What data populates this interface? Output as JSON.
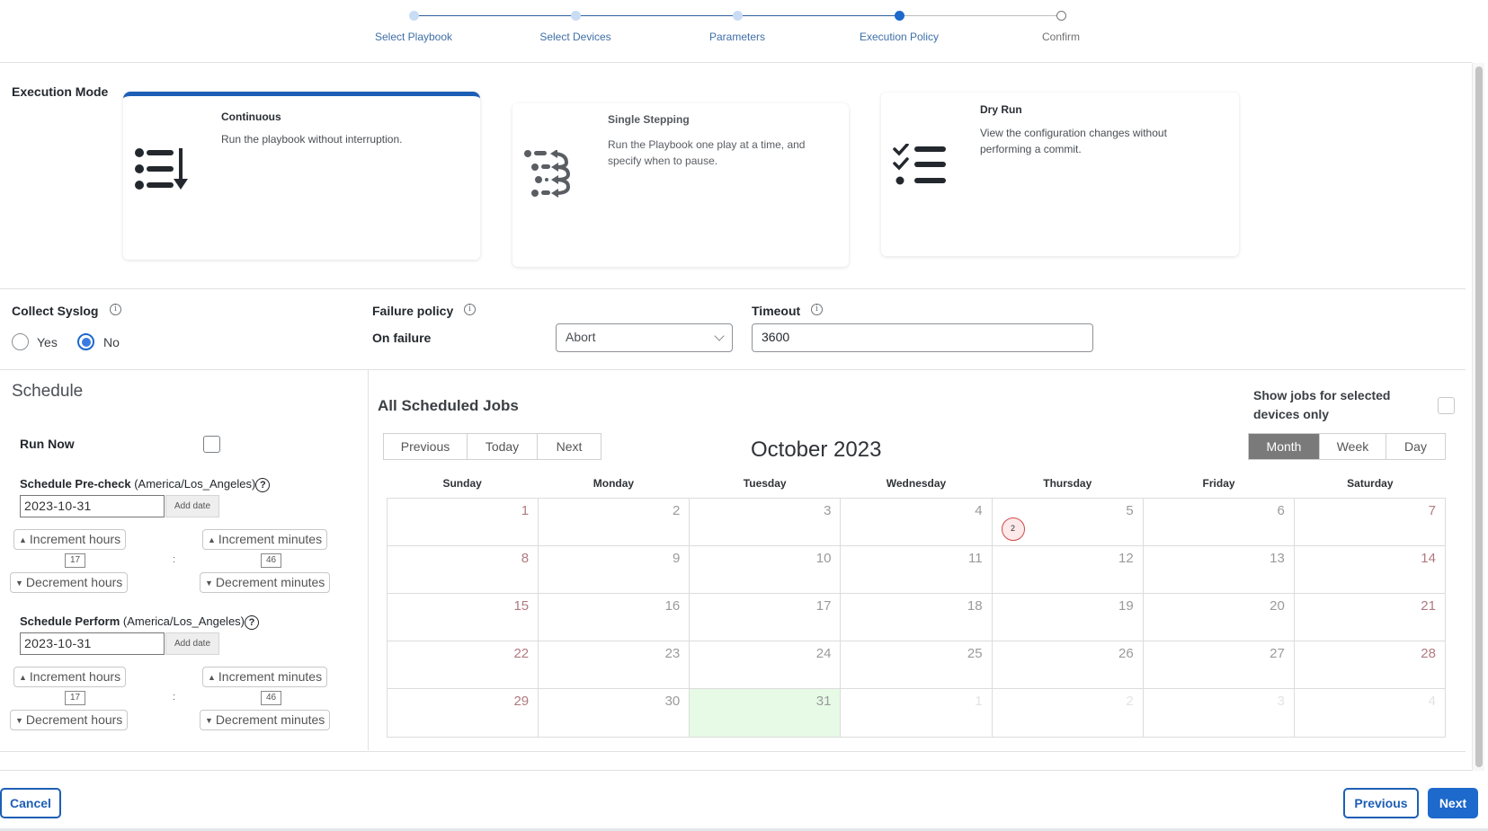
{
  "stepper": {
    "steps": [
      {
        "label": "Select Playbook",
        "state": "done"
      },
      {
        "label": "Select Devices",
        "state": "done"
      },
      {
        "label": "Parameters",
        "state": "done"
      },
      {
        "label": "Execution Policy",
        "state": "active"
      },
      {
        "label": "Confirm",
        "state": "todo"
      }
    ],
    "colors": {
      "done": "#c9dcf5",
      "active": "#1d69cc",
      "line_done": "#2f5f9e",
      "line_todo": "#bdbdbd"
    }
  },
  "execution_mode": {
    "title": "Execution Mode",
    "selected": "Continuous",
    "cards": [
      {
        "title": "Continuous",
        "description": "Run the playbook without interruption.",
        "icon": "list-arrow-down-icon"
      },
      {
        "title": "Single Stepping",
        "description": "Run the Playbook one play at a time, and specify when to pause.",
        "icon": "step-list-icon"
      },
      {
        "title": "Dry Run",
        "description": "View the configuration changes without performing a commit.",
        "icon": "checklist-icon"
      }
    ]
  },
  "collect_syslog": {
    "label": "Collect Syslog",
    "options": [
      "Yes",
      "No"
    ],
    "selected": "No"
  },
  "failure_policy": {
    "label": "Failure policy",
    "on_failure_label": "On failure",
    "selected": "Abort"
  },
  "timeout": {
    "label": "Timeout",
    "value": "3600"
  },
  "schedule": {
    "title": "Schedule",
    "run_now_label": "Run Now",
    "run_now_checked": false,
    "precheck": {
      "label": "Schedule Pre-check",
      "timezone": "(America/Los_Angeles)",
      "date": "2023-10-31",
      "add_date": "Add date",
      "increment_hours": "Increment hours",
      "increment_minutes": "Increment minutes",
      "decrement_hours": "Decrement hours",
      "decrement_minutes": "Decrement minutes",
      "hours": "17",
      "minutes": "46"
    },
    "perform": {
      "label": "Schedule Perform",
      "timezone": "(America/Los_Angeles)",
      "date": "2023-10-31",
      "add_date": "Add date",
      "increment_hours": "Increment hours",
      "increment_minutes": "Increment minutes",
      "decrement_hours": "Decrement hours",
      "decrement_minutes": "Decrement minutes",
      "hours": "17",
      "minutes": "46"
    },
    "colon": ":",
    "help": "?"
  },
  "calendar": {
    "title": "All Scheduled Jobs",
    "nav": [
      "Previous",
      "Today",
      "Next"
    ],
    "month_label": "October 2023",
    "show_selected_label": "Show jobs for selected devices only",
    "show_selected_checked": false,
    "views": [
      "Month",
      "Week",
      "Day"
    ],
    "active_view": "Month",
    "weekdays": [
      "Sunday",
      "Monday",
      "Tuesday",
      "Wednesday",
      "Thursday",
      "Friday",
      "Saturday"
    ],
    "weeks": [
      [
        {
          "d": "1"
        },
        {
          "d": "2"
        },
        {
          "d": "3"
        },
        {
          "d": "4"
        },
        {
          "d": "5",
          "badge": "2"
        },
        {
          "d": "6"
        },
        {
          "d": "7"
        }
      ],
      [
        {
          "d": "8"
        },
        {
          "d": "9"
        },
        {
          "d": "10"
        },
        {
          "d": "11"
        },
        {
          "d": "12"
        },
        {
          "d": "13"
        },
        {
          "d": "14"
        }
      ],
      [
        {
          "d": "15"
        },
        {
          "d": "16"
        },
        {
          "d": "17"
        },
        {
          "d": "18"
        },
        {
          "d": "19"
        },
        {
          "d": "20"
        },
        {
          "d": "21"
        }
      ],
      [
        {
          "d": "22"
        },
        {
          "d": "23"
        },
        {
          "d": "24"
        },
        {
          "d": "25"
        },
        {
          "d": "26"
        },
        {
          "d": "27"
        },
        {
          "d": "28"
        }
      ],
      [
        {
          "d": "29"
        },
        {
          "d": "30"
        },
        {
          "d": "31",
          "today": true
        },
        {
          "d": "1",
          "other": true
        },
        {
          "d": "2",
          "other": true
        },
        {
          "d": "3",
          "other": true
        },
        {
          "d": "4",
          "other": true
        }
      ]
    ]
  },
  "footer": {
    "cancel": "Cancel",
    "previous": "Previous",
    "next": "Next"
  },
  "info_glyph": "i"
}
